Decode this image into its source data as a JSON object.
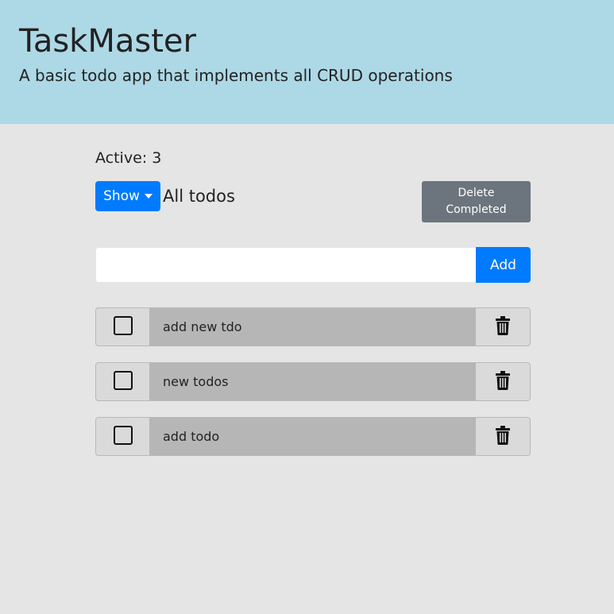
{
  "header": {
    "title": "TaskMaster",
    "subtitle": "A basic todo app that implements all CRUD operations"
  },
  "summary": {
    "active_text": "Active: 3"
  },
  "filter": {
    "button_label": "Show",
    "current_label": "All todos"
  },
  "actions": {
    "delete_completed_label": "Delete Completed"
  },
  "new_todo": {
    "value": "",
    "placeholder": "",
    "add_label": "Add"
  },
  "todos": [
    {
      "text": "add new tdo",
      "completed": false
    },
    {
      "text": "new todos",
      "completed": false
    },
    {
      "text": "add todo",
      "completed": false
    }
  ],
  "icons": {
    "dropdown": "caret-down-icon",
    "delete": "trash-icon"
  },
  "colors": {
    "header_bg": "#add8e6",
    "page_bg": "#e5e5e5",
    "primary": "#007bff",
    "secondary": "#6c757d",
    "todo_text_bg": "#b6b6b6",
    "todo_cell_bg": "#dadada"
  }
}
